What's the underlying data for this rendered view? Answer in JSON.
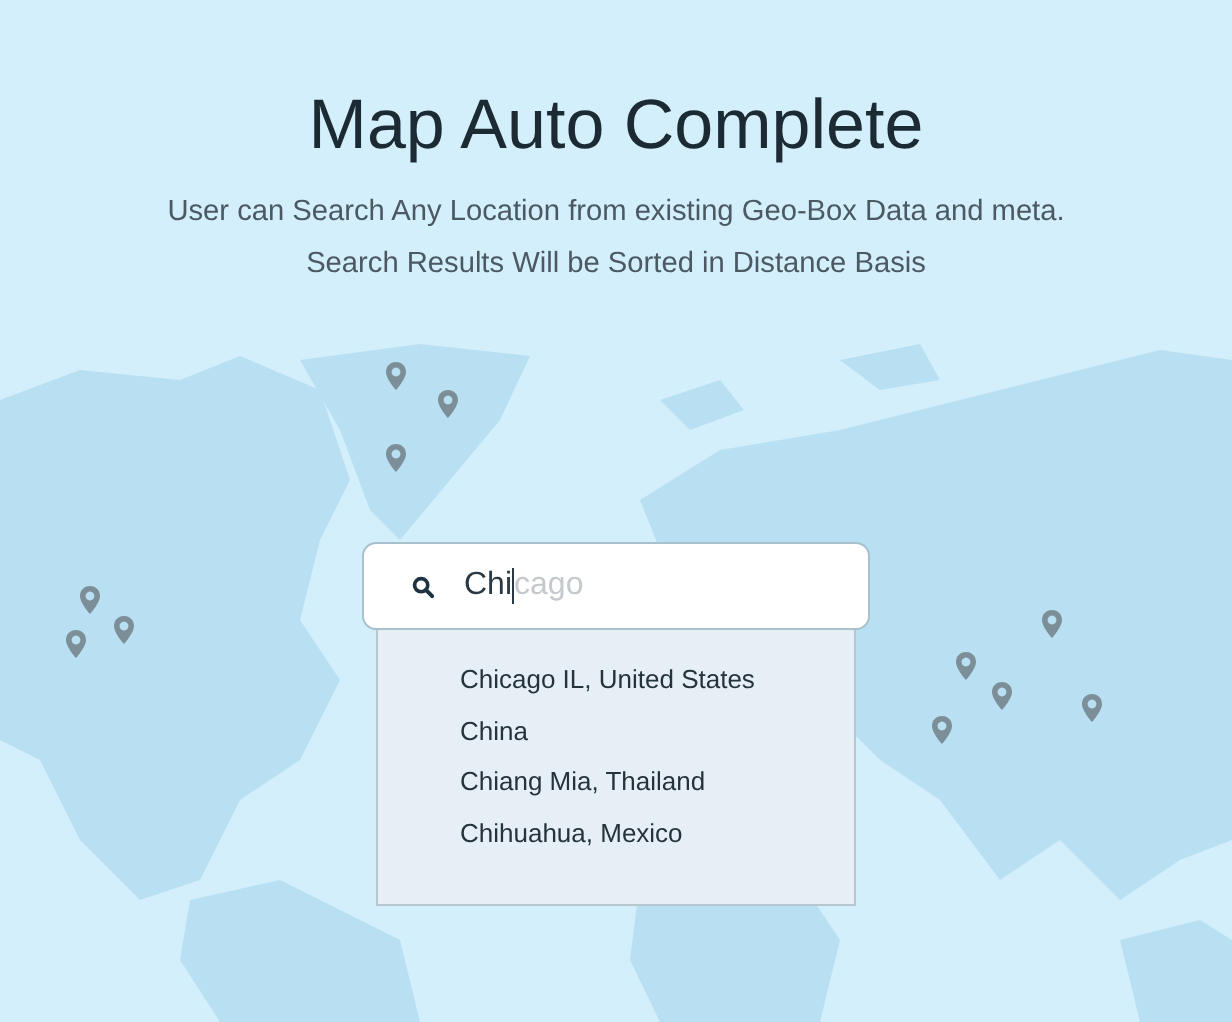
{
  "title": "Map Auto Complete",
  "subtitle": "User can Search Any Location from existing Geo-Box Data and meta. Search Results Will be Sorted in Distance Basis",
  "search": {
    "value": "Chi",
    "suggestion": "cago"
  },
  "results": [
    {
      "label": "Chicago IL, United States"
    },
    {
      "label": "China"
    },
    {
      "label": "Chiang Mia, Thailand"
    },
    {
      "label": "Chihuahua, Mexico"
    }
  ]
}
